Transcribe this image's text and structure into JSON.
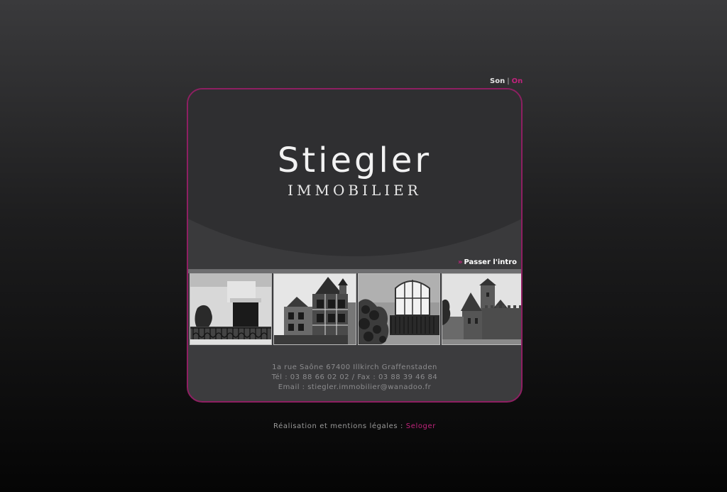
{
  "sound": {
    "label": "Son",
    "separator": "|",
    "state": "On"
  },
  "logo": {
    "brand": "Stiegler",
    "subtitle": "IMMOBILIER"
  },
  "skip_intro": {
    "bullet": "»",
    "label": "Passer l'intro"
  },
  "photos": [
    {
      "name": "balcony-photo"
    },
    {
      "name": "timbered-house-photo"
    },
    {
      "name": "window-balcony-photo"
    },
    {
      "name": "castle-photo"
    }
  ],
  "contact": {
    "address": "1a rue Saône 67400 Illkirch Graffenstaden",
    "phone_fax": "Tél : 03 88 66 02 02 / Fax : 03 88 39 46 84",
    "email": "Email : stiegler.immobilier@wanadoo.fr"
  },
  "footer": {
    "text": "Réalisation et mentions légales :",
    "link": "Seloger"
  },
  "colors": {
    "accent": "#c0237c",
    "border": "#8e1f62"
  }
}
